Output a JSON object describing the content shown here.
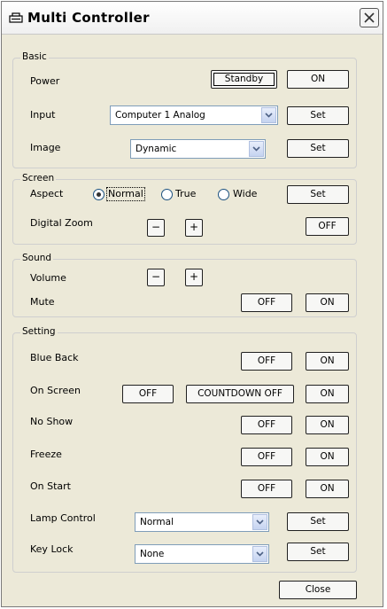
{
  "window": {
    "title": "Multi Controller"
  },
  "basic": {
    "legend": "Basic",
    "power_label": "Power",
    "standby_label": "Standby",
    "on_label": "ON",
    "input_label": "Input",
    "input_value": "Computer 1  Analog",
    "input_set_label": "Set",
    "image_label": "Image",
    "image_value": "Dynamic",
    "image_set_label": "Set"
  },
  "screen": {
    "legend": "Screen",
    "aspect_label": "Aspect",
    "aspect_options": [
      "Normal",
      "True",
      "Wide"
    ],
    "aspect_selected": "Normal",
    "aspect_set_label": "Set",
    "digital_zoom_label": "Digital Zoom",
    "minus_label": "−",
    "plus_label": "+",
    "zoom_off_label": "OFF"
  },
  "sound": {
    "legend": "Sound",
    "volume_label": "Volume",
    "minus_label": "−",
    "plus_label": "+",
    "mute_label": "Mute",
    "off_label": "OFF",
    "on_label": "ON"
  },
  "setting": {
    "legend": "Setting",
    "blue_back_label": "Blue Back",
    "on_screen_label": "On Screen",
    "countdown_off_label": "COUNTDOWN OFF",
    "no_show_label": "No Show",
    "freeze_label": "Freeze",
    "on_start_label": "On Start",
    "off_label": "OFF",
    "on_label": "ON",
    "lamp_control_label": "Lamp Control",
    "lamp_control_value": "Normal",
    "key_lock_label": "Key Lock",
    "key_lock_value": "None",
    "set_label": "Set"
  },
  "footer": {
    "close_label": "Close"
  },
  "icons": {
    "app": "projector-icon",
    "close": "close-x-icon",
    "dropdown": "chevron-down-icon"
  }
}
